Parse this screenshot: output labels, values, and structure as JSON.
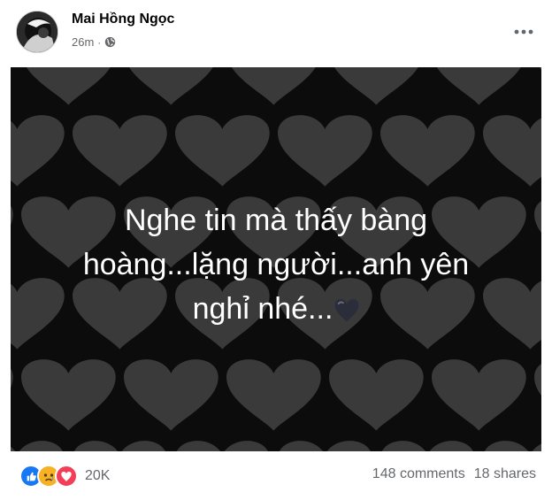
{
  "post": {
    "author": "Mai Hồng Ngọc",
    "time": "26m",
    "separator": "·",
    "privacy_icon": "globe-icon",
    "more_icon": "more-horizontal-icon"
  },
  "banner": {
    "background_color": "#0c0c0c",
    "pattern_icon": "heart-icon",
    "pattern_color": "#3a3a3a",
    "message_line1": "Nghe tin mà thấy bàng",
    "message_line2": "hoàng...lặng người...anh yên",
    "message_line3": "nghỉ nhé...",
    "emoji": "black-heart-icon"
  },
  "footer": {
    "reactions": [
      {
        "name": "like-reaction-icon",
        "color": "#1877f2"
      },
      {
        "name": "sad-reaction-icon",
        "color": "#f7b125"
      },
      {
        "name": "love-reaction-icon",
        "color": "#f33e58"
      }
    ],
    "reaction_count": "20K",
    "comments": "148 comments",
    "shares": "18 shares"
  }
}
